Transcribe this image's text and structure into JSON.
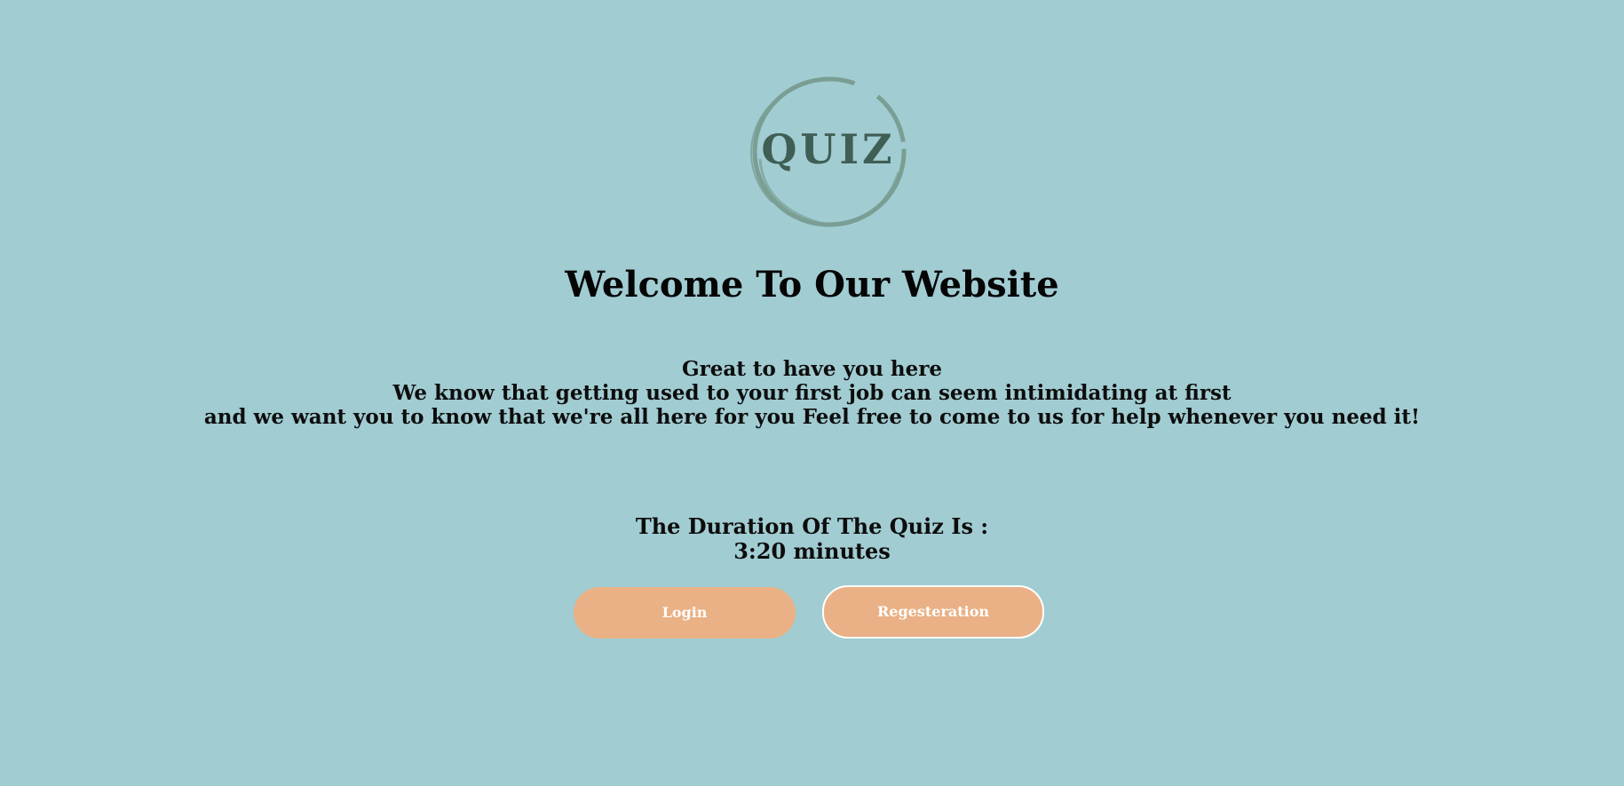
{
  "logo": {
    "text": "QUIZ",
    "ring_color": "#7a9e93",
    "text_color": "#3f5e54"
  },
  "header": {
    "title": "Welcome To Our Website"
  },
  "intro": {
    "lines": [
      "Great to have you here",
      "We know that getting used to your first job can seem intimidating at first",
      "and we want you to know that we're all here for you Feel free to come to us for help whenever you need it!"
    ]
  },
  "quiz": {
    "duration_label": "The Duration Of The Quiz Is :",
    "duration_value": "3:20 minutes"
  },
  "actions": {
    "login_label": "Login",
    "register_label": "Regesteration"
  },
  "colors": {
    "background": "#a1ccd2",
    "button": "#e9b185",
    "button_text": "#ffffff"
  }
}
